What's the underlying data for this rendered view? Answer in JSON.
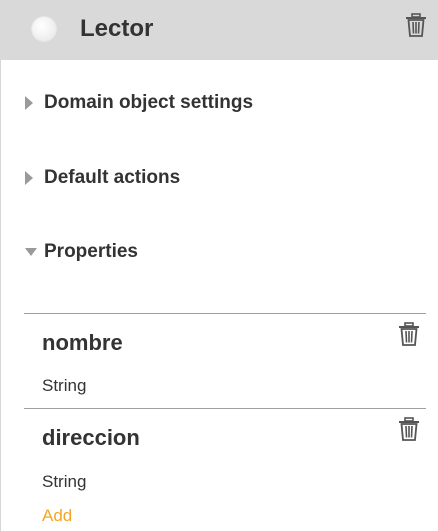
{
  "header": {
    "title": "Lector",
    "radio_icon": "radio-circle-icon",
    "delete_icon": "trash-icon"
  },
  "sections": [
    {
      "label": "Domain object settings",
      "expanded": false,
      "icon": "triangle-right-icon"
    },
    {
      "label": "Default actions",
      "expanded": false,
      "icon": "triangle-right-icon"
    },
    {
      "label": "Properties",
      "expanded": true,
      "icon": "triangle-down-icon"
    }
  ],
  "properties": [
    {
      "name": "nombre",
      "type": "String",
      "delete_icon": "trash-icon"
    },
    {
      "name": "direccion",
      "type": "String",
      "delete_icon": "trash-icon"
    }
  ],
  "add_label": "Add",
  "colors": {
    "header_bg": "#d9d9d9",
    "text": "#333333",
    "accent": "#f5a623",
    "divider": "#a0a0a0",
    "triangle": "#9a9a9a"
  }
}
